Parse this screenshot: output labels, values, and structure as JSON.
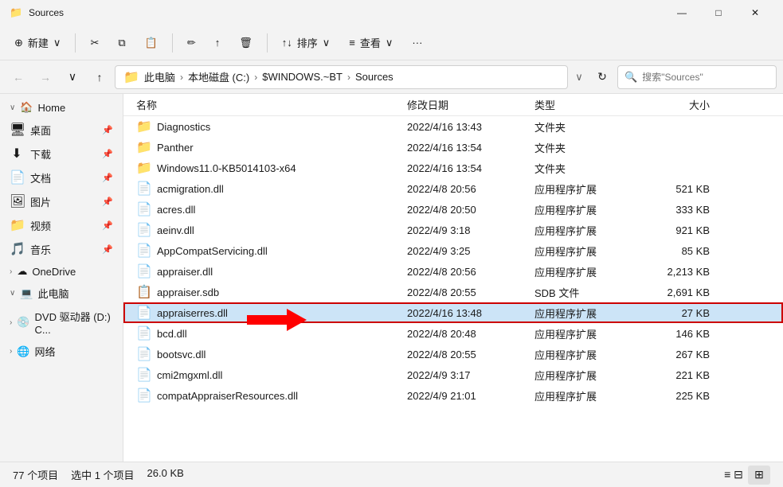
{
  "titleBar": {
    "icon": "📁",
    "title": "Sources",
    "minimizeLabel": "—",
    "maximizeLabel": "□",
    "closeLabel": "✕"
  },
  "toolbar": {
    "newLabel": "新建",
    "cutLabel": "✂",
    "copyLabel": "⧉",
    "pasteLabel": "📋",
    "renameLabel": "✏",
    "shareLabel": "↑",
    "deleteLabel": "🗑",
    "sortLabel": "排序",
    "viewLabel": "查看",
    "moreLabel": "···"
  },
  "addressBar": {
    "backLabel": "←",
    "forwardLabel": "→",
    "downLabel": "∨",
    "upLabel": "↑",
    "pathParts": [
      "此电脑",
      "本地磁盘 (C:)",
      "$WINDOWS.~BT",
      "Sources"
    ],
    "refreshLabel": "↻",
    "searchPlaceholder": "搜索\"Sources\""
  },
  "sidebar": {
    "homeLabel": "Home",
    "items": [
      {
        "label": "桌面",
        "icon": "🖥",
        "pinned": true
      },
      {
        "label": "下载",
        "icon": "⬇",
        "pinned": true
      },
      {
        "label": "文档",
        "icon": "📄",
        "pinned": true
      },
      {
        "label": "图片",
        "icon": "🖼",
        "pinned": true
      },
      {
        "label": "视频",
        "icon": "📁",
        "pinned": true
      },
      {
        "label": "音乐",
        "icon": "🎵",
        "pinned": true
      }
    ],
    "groups": [
      {
        "label": "OneDrive",
        "icon": "☁",
        "expanded": false
      },
      {
        "label": "此电脑",
        "icon": "💻",
        "expanded": true
      },
      {
        "label": "DVD 驱动器 (D:) C...",
        "icon": "💿",
        "expanded": false
      },
      {
        "label": "网络",
        "icon": "🌐",
        "expanded": false
      }
    ]
  },
  "fileList": {
    "columns": {
      "name": "名称",
      "date": "修改日期",
      "type": "类型",
      "size": "大小"
    },
    "files": [
      {
        "name": "Diagnostics",
        "date": "2022/4/16 13:43",
        "type": "文件夹",
        "size": "",
        "isFolder": true
      },
      {
        "name": "Panther",
        "date": "2022/4/16 13:54",
        "type": "文件夹",
        "size": "",
        "isFolder": true
      },
      {
        "name": "Windows11.0-KB5014103-x64",
        "date": "2022/4/16 13:54",
        "type": "文件夹",
        "size": "",
        "isFolder": true
      },
      {
        "name": "acmigration.dll",
        "date": "2022/4/8 20:56",
        "type": "应用程序扩展",
        "size": "521 KB",
        "isFolder": false
      },
      {
        "name": "acres.dll",
        "date": "2022/4/8 20:50",
        "type": "应用程序扩展",
        "size": "333 KB",
        "isFolder": false
      },
      {
        "name": "aeinv.dll",
        "date": "2022/4/9 3:18",
        "type": "应用程序扩展",
        "size": "921 KB",
        "isFolder": false
      },
      {
        "name": "AppCompatServicing.dll",
        "date": "2022/4/9 3:25",
        "type": "应用程序扩展",
        "size": "85 KB",
        "isFolder": false
      },
      {
        "name": "appraiser.dll",
        "date": "2022/4/8 20:56",
        "type": "应用程序扩展",
        "size": "2,213 KB",
        "isFolder": false
      },
      {
        "name": "appraiser.sdb",
        "date": "2022/4/8 20:55",
        "type": "SDB 文件",
        "size": "2,691 KB",
        "isFolder": false
      },
      {
        "name": "appraiserres.dll",
        "date": "2022/4/16 13:48",
        "type": "应用程序扩展",
        "size": "27 KB",
        "isFolder": false,
        "selected": true,
        "annotated": true
      },
      {
        "name": "bcd.dll",
        "date": "2022/4/8 20:48",
        "type": "应用程序扩展",
        "size": "146 KB",
        "isFolder": false
      },
      {
        "name": "bootsvc.dll",
        "date": "2022/4/8 20:55",
        "type": "应用程序扩展",
        "size": "267 KB",
        "isFolder": false
      },
      {
        "name": "cmi2mgxml.dll",
        "date": "2022/4/9 3:17",
        "type": "应用程序扩展",
        "size": "221 KB",
        "isFolder": false
      },
      {
        "name": "compatAppraiserResources.dll",
        "date": "2022/4/9 21:01",
        "type": "应用程序扩展",
        "size": "225 KB",
        "isFolder": false
      }
    ]
  },
  "statusBar": {
    "totalItems": "77 个项目",
    "selectedItems": "选中 1 个项目",
    "selectedSize": "26.0 KB",
    "listViewLabel": "≡",
    "gridViewLabel": "⊞"
  }
}
